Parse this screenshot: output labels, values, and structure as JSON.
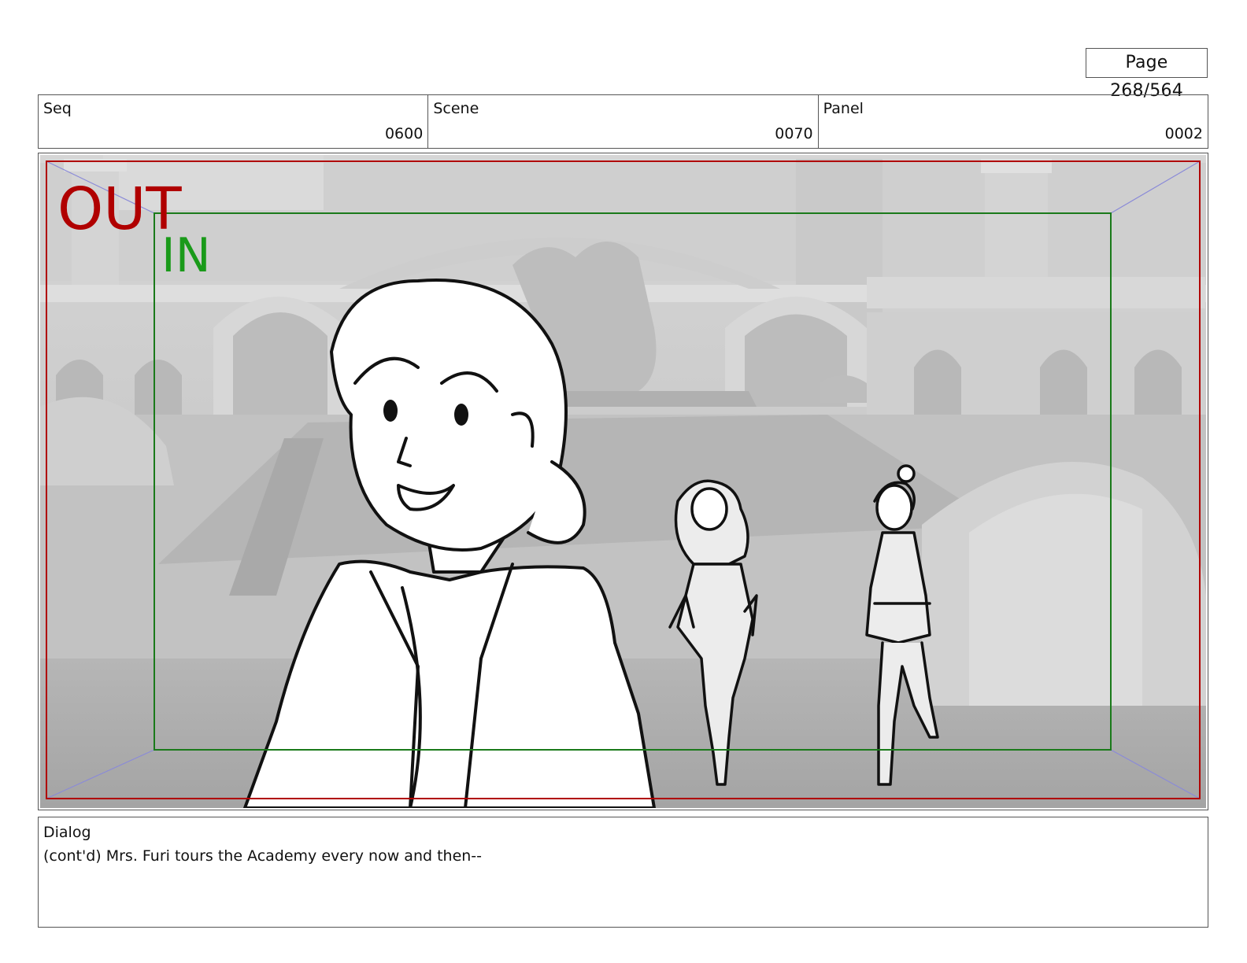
{
  "page": {
    "label": "Page 268/564"
  },
  "header": {
    "seq": {
      "label": "Seq",
      "value": "0600"
    },
    "scene": {
      "label": "Scene",
      "value": "0070"
    },
    "panel": {
      "label": "Panel",
      "value": "0002"
    }
  },
  "frame": {
    "out_label": "OUT",
    "in_label": "IN",
    "colors": {
      "out": "#b00000",
      "in": "#1a9a1a",
      "diagonal": "#8a8ad8",
      "background": "#c4c4c4"
    }
  },
  "dialog": {
    "label": "Dialog",
    "text": "(cont'd) Mrs. Furi tours the Academy every now and then--"
  }
}
